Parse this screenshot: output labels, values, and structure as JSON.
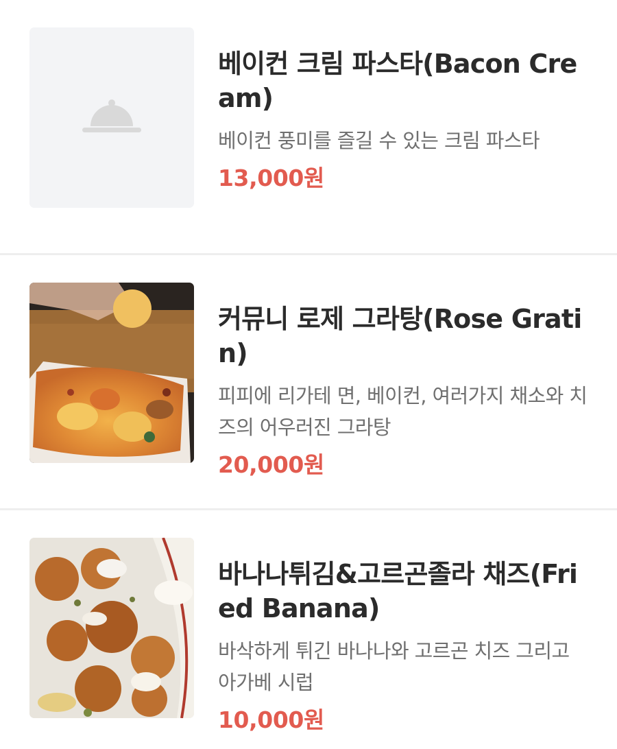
{
  "menu": {
    "items": [
      {
        "title": "베이컨 크림 파스타(Bacon Cream)",
        "description": "베이컨 풍미를 즐길 수 있는 크림 파스타",
        "price": "13,000원",
        "image": "placeholder-cloche-icon"
      },
      {
        "title": "커뮤니 로제 그라탕(Rose Gratin)",
        "description": "피피에 리가테 면, 베이컨, 여러가지 채소와 치즈의 어우러진 그라탕",
        "price": "20,000원",
        "image": "rose-gratin-photo"
      },
      {
        "title": "바나나튀김&고르곤졸라 채즈(Fried Banana)",
        "description": "바삭하게 튀긴 바나나와 고르곤 치즈 그리고 아가베 시럽",
        "price": "10,000원",
        "image": "fried-banana-photo"
      }
    ]
  },
  "colors": {
    "price": "#e25b4f",
    "title": "#2b2b2b",
    "description": "#6f6f6f",
    "divider": "#eeeeee",
    "placeholder_bg": "#f3f4f6"
  }
}
